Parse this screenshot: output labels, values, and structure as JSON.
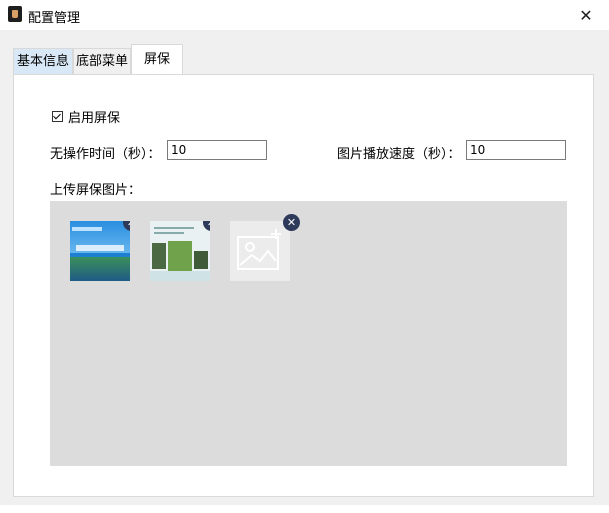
{
  "window": {
    "title": "配置管理",
    "close_glyph": "✕"
  },
  "tabs": [
    {
      "label": "基本信息",
      "active": false
    },
    {
      "label": "底部菜单",
      "active": false
    },
    {
      "label": "屏保",
      "active": true
    }
  ],
  "screensaver": {
    "enable_label": "启用屏保",
    "enabled": true,
    "idle_time_label": "无操作时间（秒）：",
    "idle_time_value": "10",
    "play_speed_label": "图片播放速度（秒）：",
    "play_speed_value": "10",
    "upload_label": "上传屏保图片："
  },
  "images": [
    {
      "kind": "poster-blue",
      "remove_glyph": "✕"
    },
    {
      "kind": "poster-light",
      "remove_glyph": "✕"
    },
    {
      "kind": "placeholder",
      "remove_glyph": "✕"
    }
  ],
  "colors": {
    "active_tab_bg": "#ffffff",
    "first_tab_bg": "#d9e8f7",
    "upload_area_bg": "#dcdcdc",
    "remove_badge_bg": "#2d3a59"
  }
}
